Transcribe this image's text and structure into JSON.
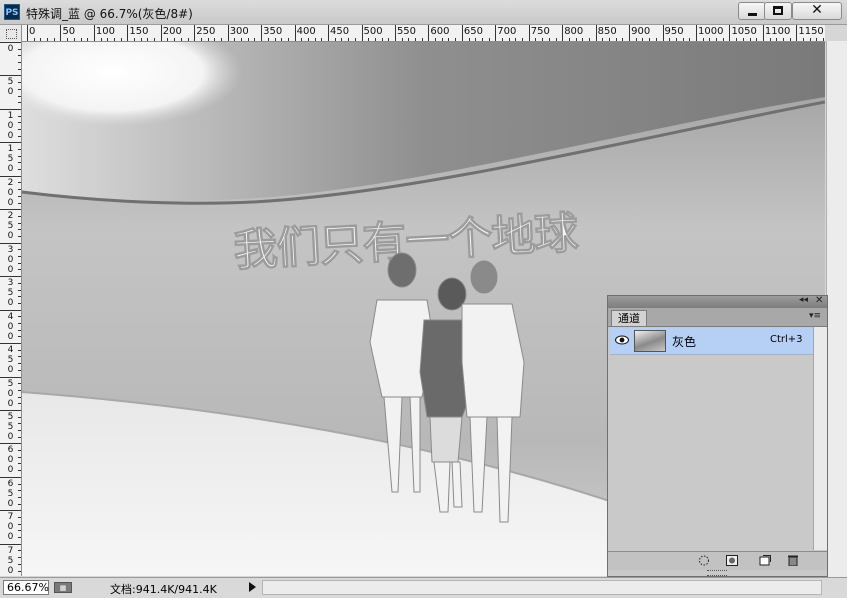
{
  "window": {
    "app_icon": "PS",
    "title": "特殊调_蓝 @ 66.7%(灰色/8#)",
    "buttons": {
      "minimize": "minimize-icon",
      "maximize": "maximize-icon",
      "close": "close-icon"
    }
  },
  "rulers": {
    "horizontal_labels": [
      "0",
      "50",
      "100",
      "150",
      "200",
      "250",
      "300",
      "350",
      "400",
      "450",
      "500",
      "550",
      "600",
      "650",
      "700",
      "750",
      "800",
      "850",
      "900",
      "950",
      "1000",
      "1050",
      "1100",
      "1150"
    ],
    "vertical_labels": [
      "0",
      "50",
      "100",
      "150",
      "200",
      "250",
      "300",
      "350",
      "400",
      "450",
      "500",
      "550",
      "600",
      "650",
      "700",
      "750"
    ]
  },
  "canvas": {
    "wall_text": "我们只有一个地球"
  },
  "channels_panel": {
    "tab": "通道",
    "channels": [
      {
        "name": "灰色",
        "shortcut": "Ctrl+3",
        "visible": true,
        "selected": true
      }
    ],
    "footer_icons": [
      "load-selection-icon",
      "save-selection-icon",
      "new-channel-icon",
      "delete-channel-icon"
    ]
  },
  "status": {
    "zoom": "66.67%",
    "doc_info": "文档:941.4K/941.4K"
  },
  "colors": {
    "selection": "#b6cff5",
    "chrome": "#d6d6d6"
  }
}
